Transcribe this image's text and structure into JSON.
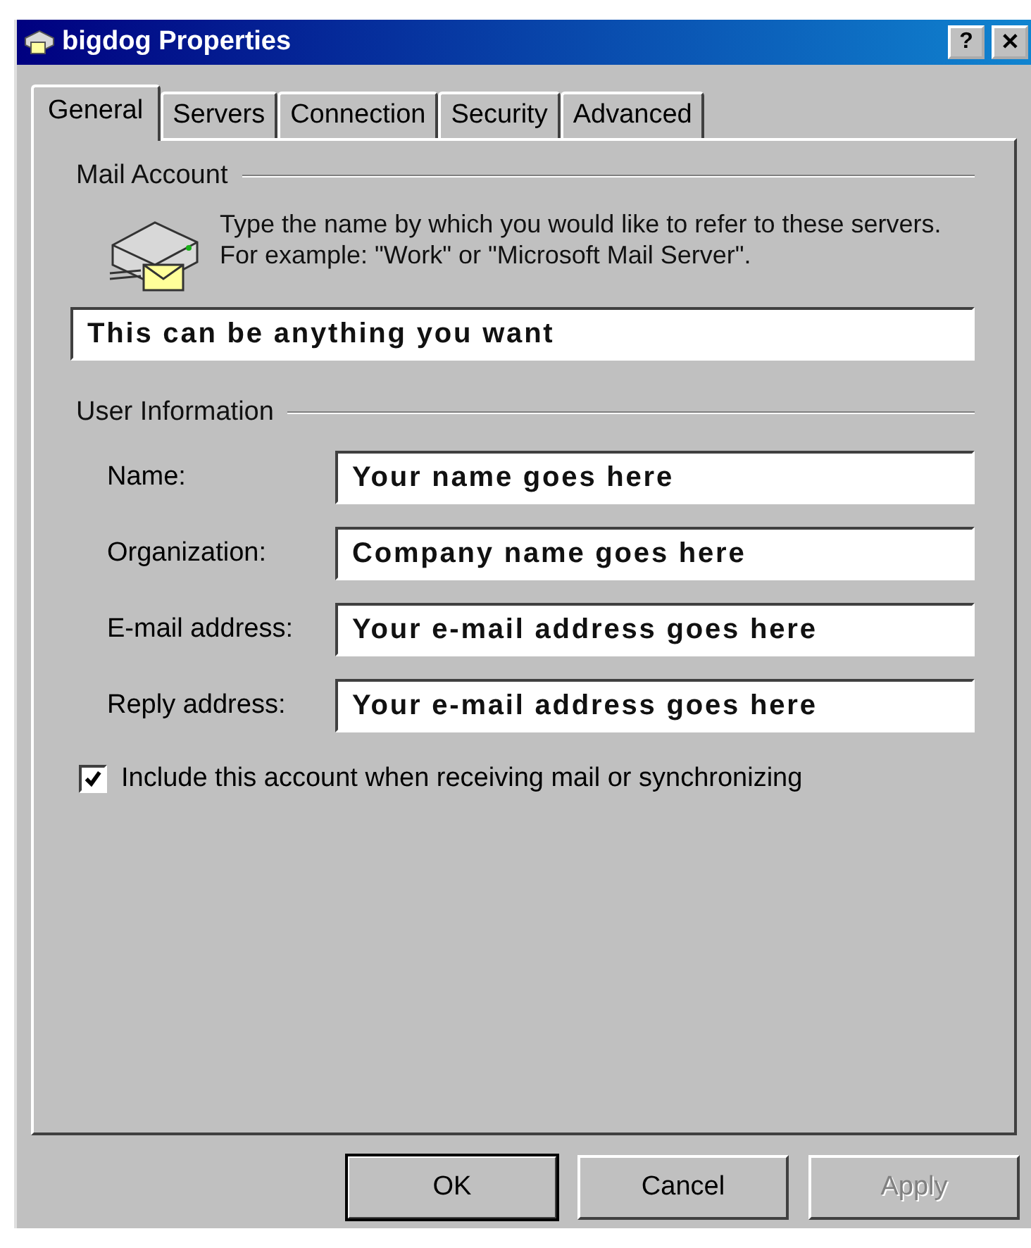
{
  "window": {
    "title": "bigdog Properties",
    "buttons": [
      "?",
      "✕"
    ]
  },
  "tabs": [
    {
      "label": "General",
      "selected": true
    },
    {
      "label": "Servers",
      "selected": false
    },
    {
      "label": "Connection",
      "selected": false
    },
    {
      "label": "Security",
      "selected": false
    },
    {
      "label": "Advanced",
      "selected": false
    }
  ],
  "mail_account": {
    "heading": "Mail Account",
    "description": "Type the name by which you would like to refer to these servers.  For example: \"Work\" or \"Microsoft Mail Server\".",
    "value": "This can be anything you want"
  },
  "user_information": {
    "heading": "User Information",
    "fields": [
      {
        "label": "Name:",
        "value": "Your name goes here"
      },
      {
        "label": "Organization:",
        "value": "Company name goes here"
      },
      {
        "label": "E-mail address:",
        "value": "Your e-mail address goes here"
      },
      {
        "label": "Reply address:",
        "value": "Your e-mail address goes here"
      }
    ]
  },
  "include_checkbox": {
    "label": "Include this account when receiving mail or synchronizing",
    "checked": true
  },
  "buttons": [
    {
      "label": "OK",
      "disabled": false,
      "default": true
    },
    {
      "label": "Cancel",
      "disabled": false,
      "default": false
    },
    {
      "label": "Apply",
      "disabled": true,
      "default": false
    }
  ]
}
